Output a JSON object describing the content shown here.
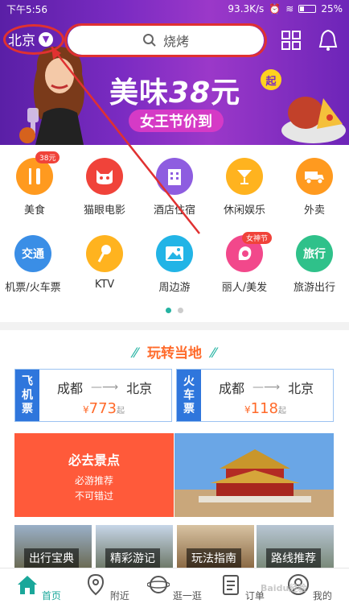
{
  "status_bar": {
    "time": "下午5:56",
    "speed": "93.3K/s",
    "battery": "25%"
  },
  "header": {
    "city": "北京",
    "search_placeholder": "烧烤"
  },
  "banner": {
    "title_prefix": "美味",
    "title_num": "38",
    "title_suffix": "元",
    "badge": "起",
    "subtitle": "女王节价到"
  },
  "categories": [
    {
      "label": "美食",
      "color": "#ff9a1f",
      "icon": "fork-knife-icon",
      "tag": "38元"
    },
    {
      "label": "猫眼电影",
      "color": "#f0433a",
      "icon": "cat-icon"
    },
    {
      "label": "酒店住宿",
      "color": "#8e5de0",
      "icon": "hotel-icon"
    },
    {
      "label": "休闲娱乐",
      "color": "#ffb31f",
      "icon": "cocktail-icon"
    },
    {
      "label": "外卖",
      "color": "#ff9a1f",
      "icon": "delivery-icon"
    },
    {
      "label": "机票/火车票",
      "color": "#3a8ee6",
      "icon": "transport-icon",
      "icon_text": "交通"
    },
    {
      "label": "KTV",
      "color": "#ffb31f",
      "icon": "microphone-icon"
    },
    {
      "label": "周边游",
      "color": "#22b4e6",
      "icon": "landscape-icon"
    },
    {
      "label": "丽人/美发",
      "color": "#f2488b",
      "icon": "beauty-icon",
      "tag": "女神节"
    },
    {
      "label": "旅游出行",
      "color": "#2fc18a",
      "icon": "travel-icon",
      "icon_text": "旅行"
    }
  ],
  "local": {
    "title": "玩转当地",
    "flight": {
      "kind_1": "飞",
      "kind_2": "机",
      "kind_3": "票",
      "from": "成都",
      "to": "北京",
      "currency": "¥",
      "price": "773",
      "unit": "起"
    },
    "train": {
      "kind_1": "火",
      "kind_2": "车",
      "kind_3": "票",
      "from": "成都",
      "to": "北京",
      "currency": "¥",
      "price": "118",
      "unit": "起"
    },
    "spot": {
      "title": "必去景点",
      "line1": "必游推荐",
      "line2": "不可错过"
    },
    "thumbs": [
      "出行宝典",
      "精彩游记",
      "玩法指南",
      "路线推荐"
    ]
  },
  "tabbar": [
    {
      "label": "首页",
      "active": true
    },
    {
      "label": "附近"
    },
    {
      "label": "逛一逛"
    },
    {
      "label": "订单"
    },
    {
      "label": "我的"
    }
  ],
  "watermark": "Baidu经验"
}
